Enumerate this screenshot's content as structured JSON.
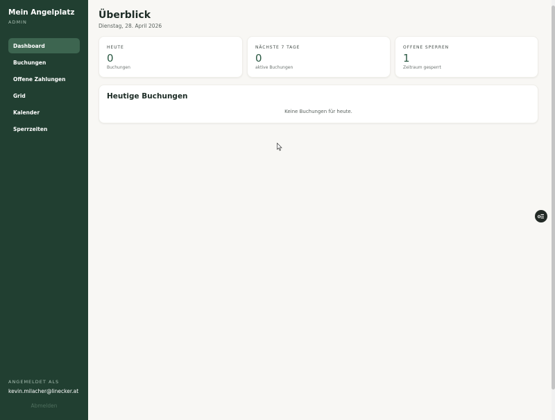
{
  "sidebar": {
    "brand": "Mein Angelplatz",
    "role": "ADMIN",
    "items": [
      {
        "label": "Dashboard"
      },
      {
        "label": "Buchungen"
      },
      {
        "label": "Offene Zahlungen"
      },
      {
        "label": "Grid"
      },
      {
        "label": "Kalender"
      },
      {
        "label": "Sperrzeiten"
      }
    ],
    "active_item": "Dashboard",
    "user_label": "ANGEMELDET ALS",
    "user_email": "kevin.milacher@linecker.at",
    "logout_label": "Abmelden"
  },
  "main": {
    "title": "Überblick",
    "date": "Dienstag, 28. April 2026",
    "stats": [
      {
        "label": "HEUTE",
        "value": "0",
        "sub": "Buchungen"
      },
      {
        "label": "NÄCHSTE 7 TAGE",
        "value": "0",
        "sub": "aktive Buchungen"
      },
      {
        "label": "OFFENE SPERREN",
        "value": "1",
        "sub": "Zeitraum gesperrt"
      }
    ],
    "today_panel": {
      "title": "Heutige Buchungen",
      "empty_text": "Keine Buchungen für heute."
    }
  },
  "colors": {
    "sidebar_bg": "#213f31",
    "sidebar_active": "#3d6550",
    "accent_value": "#2a5842",
    "page_bg": "#f8f7f4",
    "fab_bg": "#232a26"
  },
  "icons": {
    "fab": "toggle-list-icon",
    "cursor": "mouse-pointer-icon"
  }
}
